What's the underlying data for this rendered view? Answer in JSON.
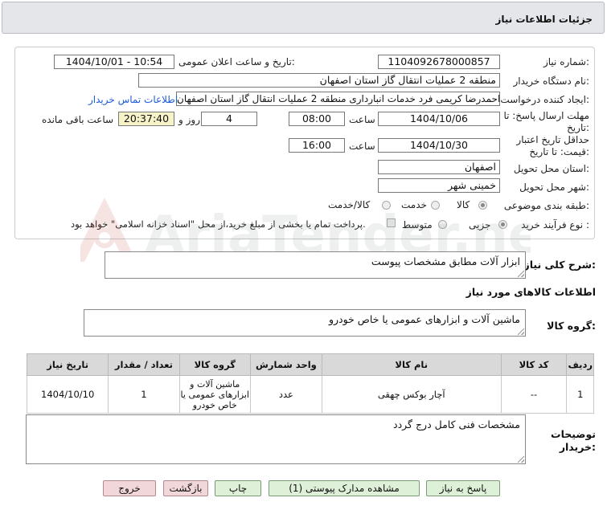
{
  "header": {
    "title": "جزئیات اطلاعات نیاز"
  },
  "form": {
    "need_number_label": "شماره نیاز:",
    "need_number": "1104092678000857",
    "announce_label": "تاریخ و ساعت اعلان عمومی:",
    "announce_value": "1404/10/01 - 10:54",
    "buyer_label": "نام دستگاه خریدار:",
    "buyer_value": "منطقه 2 عملیات انتقال گاز استان اصفهان",
    "creator_label": "ایجاد کننده درخواست:",
    "creator_value": "احمدرضا کریمی فرد خدمات انبارداری منطقه 2 عملیات انتقال گاز استان اصفهان",
    "contact_link": "اطلاعات تماس خریدار",
    "deadline_label_1": "مهلت ارسال پاسخ: تا",
    "deadline_label_2": "تاریخ:",
    "deadline_date": "1404/10/06",
    "time_label": "ساعت",
    "deadline_time": "08:00",
    "days_value": "4",
    "days_label": "روز و",
    "remaining_time": "20:37:40",
    "remaining_label": "ساعت باقی مانده",
    "validity_label_1": "حداقل تاریخ اعتبار",
    "validity_label_2": "قیمت: تا تاریخ:",
    "validity_date": "1404/10/30",
    "validity_time": "16:00",
    "province_label": "استان محل تحویل:",
    "province_value": "اصفهان",
    "city_label": "شهر محل تحویل:",
    "city_value": "خمینی شهر",
    "category_label": "طبقه بندی موضوعی:",
    "category_options": [
      "کالا",
      "خدمت",
      "کالا/خدمت"
    ],
    "process_label": "نوع فرآیند خرید :",
    "process_options": [
      "جزیی",
      "متوسط"
    ],
    "payment_note": "پرداخت تمام یا بخشی از مبلغ خرید،از محل \"اسناد خزانه اسلامی\" خواهد بود."
  },
  "description": {
    "label": "شرح کلی نیاز:",
    "value": "ابزار آلات مطابق مشخصات پیوست"
  },
  "goods": {
    "section_title": "اطلاعات کالاهای مورد نیاز",
    "group_label": "گروه کالا:",
    "group_value": "ماشین آلات و ابزارهای عمومی یا خاص خودرو",
    "columns": [
      "ردیف",
      "کد کالا",
      "نام کالا",
      "واحد شمارش",
      "گروه کالا",
      "تعداد / مقدار",
      "تاریخ نیاز"
    ],
    "rows": [
      [
        "1",
        "--",
        "آچار بوکس چهقی",
        "عدد",
        "ماشین آلات و ابزارهای عمومی یا خاص خودرو",
        "1",
        "1404/10/10"
      ]
    ]
  },
  "buyer_notes": {
    "label_1": "توضیحات",
    "label_2": "خریدار:",
    "value": "مشخصات فنی کامل درج گردد"
  },
  "buttons": {
    "reply": "پاسخ به نیاز",
    "view_docs": "مشاهده مدارک پیوستی (1)",
    "print": "چاپ",
    "back": "بازگشت",
    "exit": "خروج"
  },
  "watermark_text": "AriaTender.neT",
  "colors": {
    "link": "#1e5bd8",
    "button_green": "#dff0d8",
    "button_pink": "#f2d7da",
    "header_bg": "#e4e6ea"
  }
}
